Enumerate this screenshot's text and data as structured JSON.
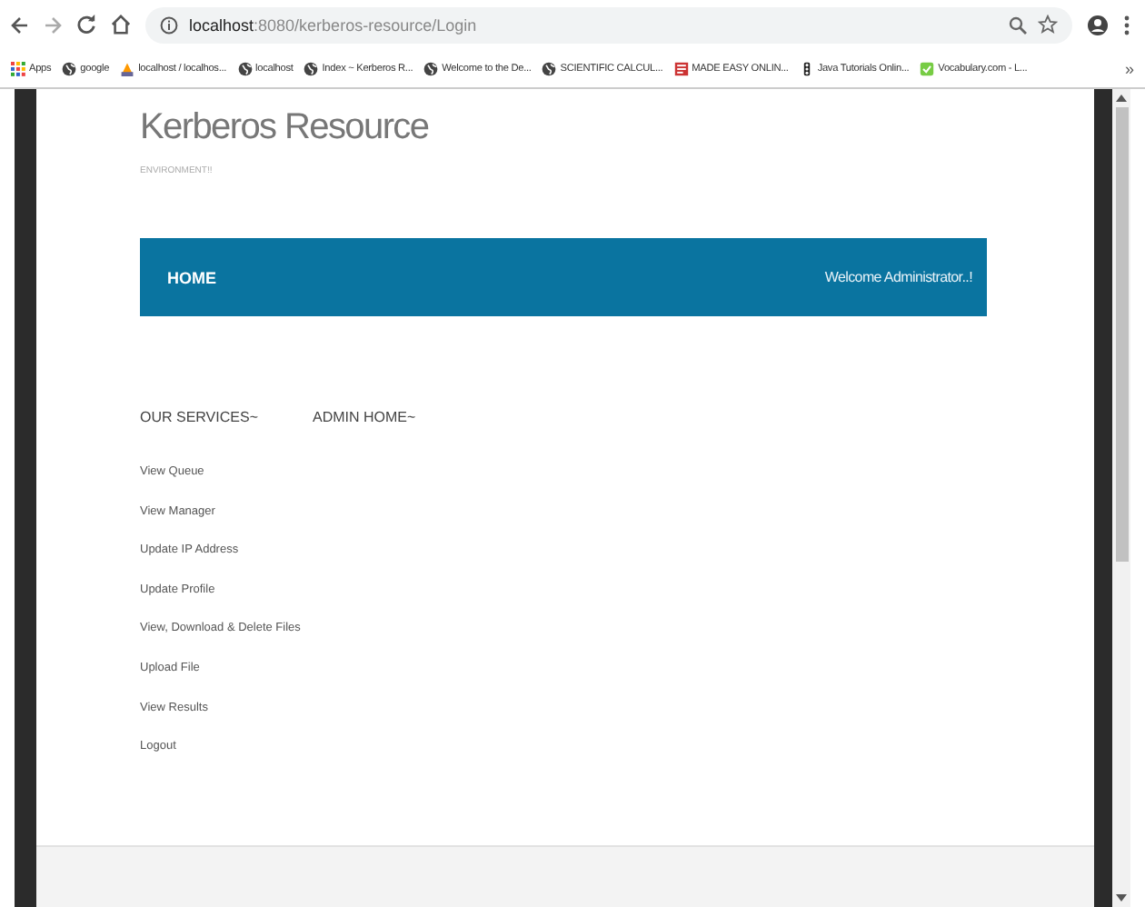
{
  "browser": {
    "url_host": "localhost",
    "url_rest": ":8080/kerberos-resource/Login",
    "bookmarks": [
      {
        "kind": "apps",
        "label": "Apps"
      },
      {
        "kind": "globe",
        "label": "google"
      },
      {
        "kind": "pma",
        "label": "localhost / localhos..."
      },
      {
        "kind": "globe",
        "label": "localhost"
      },
      {
        "kind": "globe",
        "label": "Index ~ Kerberos R..."
      },
      {
        "kind": "globe",
        "label": "Welcome to the De..."
      },
      {
        "kind": "globe",
        "label": "SCIENTIFIC CALCUL..."
      },
      {
        "kind": "doc",
        "label": "MADE EASY ONLIN..."
      },
      {
        "kind": "lights",
        "label": "Java Tutorials Onlin..."
      },
      {
        "kind": "check",
        "label": "Vocabulary.com - L..."
      }
    ],
    "more": "»"
  },
  "site": {
    "title": "Kerberos Resource",
    "subtitle": "ENVIRONMENT!!"
  },
  "navbar": {
    "home": "HOME",
    "welcome": "Welcome Administrator..!"
  },
  "menus": [
    {
      "label": "OUR SERVICES~"
    },
    {
      "label": "ADMIN HOME~"
    }
  ],
  "links": [
    "View Queue",
    "View Manager",
    "Update IP Address",
    "Update Profile",
    "View, Download & Delete Files",
    "Upload File",
    "View Results",
    "Logout"
  ]
}
